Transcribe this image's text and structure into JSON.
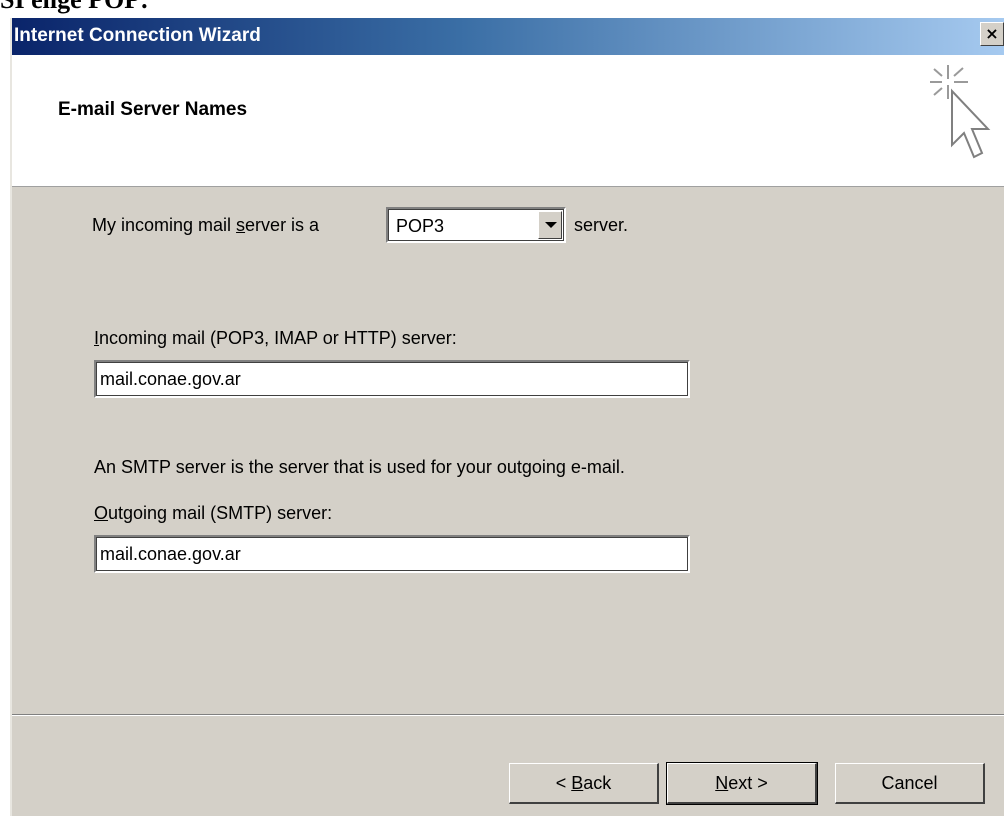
{
  "page_caption": "SI eligé POP:",
  "window": {
    "title": "Internet Connection Wizard",
    "close_glyph": "×"
  },
  "header": {
    "title": "E-mail Server Names",
    "icon": "wizard-cursor-sparkle-icon"
  },
  "server_type": {
    "label_before": "My incoming mail ",
    "label_accel": "s",
    "label_after": "erver is a",
    "value": "POP3",
    "suffix": "server."
  },
  "incoming": {
    "label_accel": "I",
    "label_rest": "ncoming mail (POP3, IMAP or HTTP) server:",
    "value": "mail.conae.gov.ar"
  },
  "smtp_note": "An SMTP server is the server that is used for your outgoing e-mail.",
  "outgoing": {
    "label_accel": "O",
    "label_rest": "utgoing mail (SMTP) server:",
    "value": "mail.conae.gov.ar"
  },
  "buttons": {
    "back_prefix": "< ",
    "back_accel": "B",
    "back_rest": "ack",
    "next_accel": "N",
    "next_rest": "ext >",
    "cancel": "Cancel"
  },
  "colors": {
    "dialog_face": "#d4d0c8",
    "titlebar_start": "#0a246a",
    "titlebar_end": "#a6caf0"
  }
}
